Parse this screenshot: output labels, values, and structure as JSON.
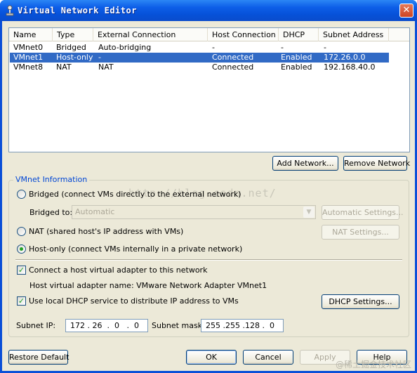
{
  "window": {
    "title": "Virtual Network Editor",
    "close": "✕"
  },
  "list": {
    "columns": [
      "Name",
      "Type",
      "External Connection",
      "Host Connection",
      "DHCP",
      "Subnet Address"
    ],
    "rows": [
      {
        "name": "VMnet0",
        "type": "Bridged",
        "external": "Auto-bridging",
        "host": "-",
        "dhcp": "-",
        "subnet": "-"
      },
      {
        "name": "VMnet1",
        "type": "Host-only",
        "external": "-",
        "host": "Connected",
        "dhcp": "Enabled",
        "subnet": "172.26.0.0"
      },
      {
        "name": "VMnet8",
        "type": "NAT",
        "external": "NAT",
        "host": "Connected",
        "dhcp": "Enabled",
        "subnet": "192.168.40.0"
      }
    ],
    "selected_index": 1
  },
  "buttons": {
    "add_network": "Add Network...",
    "remove_network": "Remove Network",
    "automatic_settings": "Automatic Settings...",
    "nat_settings": "NAT Settings...",
    "dhcp_settings": "DHCP Settings...",
    "restore_default": "Restore Default",
    "ok": "OK",
    "cancel": "Cancel",
    "apply": "Apply",
    "help": "Help"
  },
  "vmnet_info": {
    "title": "VMnet Information",
    "bridged_label": "Bridged (connect VMs directly to the external network)",
    "bridged_to_label": "Bridged to:",
    "bridged_to_value": "Automatic",
    "nat_label": "NAT (shared host's IP address with VMs)",
    "hostonly_label": "Host-only (connect VMs internally in a private network)",
    "selected_mode": "host-only",
    "connect_adapter_label": "Connect a host virtual adapter to this network",
    "connect_adapter_checked": true,
    "adapter_name_text": "Host virtual adapter name: VMware Network Adapter VMnet1",
    "dhcp_label": "Use local DHCP service to distribute IP address to VMs",
    "dhcp_checked": true,
    "subnet_ip_label": "Subnet IP:",
    "subnet_ip": "172 . 26  .  0   .  0",
    "subnet_mask_label": "Subnet mask:",
    "subnet_mask": "255 .255 .128 .  0"
  },
  "watermark": "http://blog.csdn.net/",
  "corner_mark": "@稀土掘金技术社区",
  "colors": {
    "selection": "#316ac5",
    "title_bar": "#0651d8",
    "group_title": "#0046d5"
  }
}
